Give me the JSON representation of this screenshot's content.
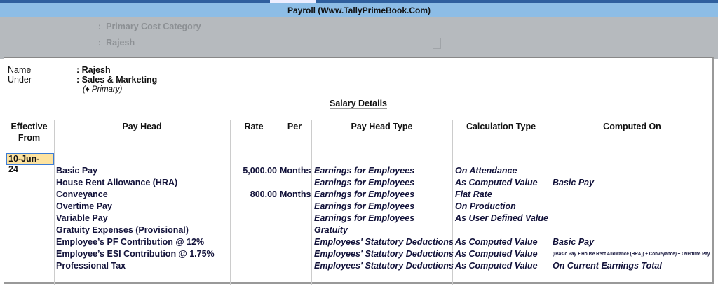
{
  "window": {
    "title": "Payroll (Www.TallyPrimeBook.Com)"
  },
  "background": {
    "category": "Primary Cost Category",
    "name": "Rajesh"
  },
  "employee": {
    "name_label": "Name",
    "name_value": "Rajesh",
    "under_label": "Under",
    "under_value": "Sales & Marketing",
    "parent": "(♦ Primary)"
  },
  "section_title": "Salary Details",
  "table": {
    "headers": [
      "Effective From",
      "Pay Head",
      "Rate",
      "Per",
      "Pay Head Type",
      "Calculation Type",
      "Computed On"
    ],
    "effective_from": "10-Jun-24",
    "rows": [
      {
        "pay_head": "Basic Pay",
        "rate": "5,000.00",
        "per": "Months",
        "type": "Earnings for Employees",
        "calc": "On Attendance",
        "computed_on": ""
      },
      {
        "pay_head": "House Rent Allowance (HRA)",
        "rate": "",
        "per": "",
        "type": "Earnings for Employees",
        "calc": "As Computed Value",
        "computed_on": "Basic Pay"
      },
      {
        "pay_head": "Conveyance",
        "rate": "800.00",
        "per": "Months",
        "type": "Earnings for Employees",
        "calc": "Flat Rate",
        "computed_on": ""
      },
      {
        "pay_head": "Overtime Pay",
        "rate": "",
        "per": "",
        "type": "Earnings for Employees",
        "calc": "On Production",
        "computed_on": ""
      },
      {
        "pay_head": "Variable Pay",
        "rate": "",
        "per": "",
        "type": "Earnings for Employees",
        "calc": "As User Defined Value",
        "computed_on": ""
      },
      {
        "pay_head": "Gratuity Expenses (Provisional)",
        "rate": "",
        "per": "",
        "type": "Gratuity",
        "calc": "",
        "computed_on": ""
      },
      {
        "pay_head": "Employee’s PF Contribution @ 12%",
        "rate": "",
        "per": "",
        "type": "Employees' Statutory Deductions",
        "calc": "As Computed Value",
        "computed_on": "Basic Pay"
      },
      {
        "pay_head": "Employee’s ESI Contribution @ 1.75%",
        "rate": "",
        "per": "",
        "type": "Employees' Statutory Deductions",
        "calc": "As Computed Value",
        "computed_on": "((Basic Pay + House Rent Allowance (HRA)) + Conveyance) + Overtime Pay"
      },
      {
        "pay_head": "Professional Tax",
        "rate": "",
        "per": "",
        "type": "Employees' Statutory Deductions",
        "calc": "As Computed Value",
        "computed_on": "On Current Earnings Total"
      }
    ]
  }
}
